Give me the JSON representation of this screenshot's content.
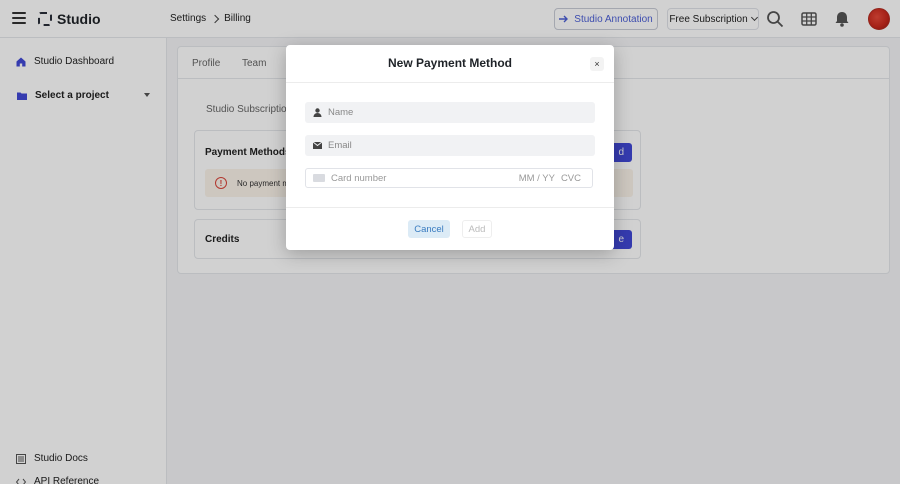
{
  "app": {
    "name": "Studio"
  },
  "breadcrumb": {
    "items": [
      "Settings",
      "Billing"
    ]
  },
  "header": {
    "annotation_label": "Studio Annotation",
    "subscription_label": "Free Subscription"
  },
  "sidebar": {
    "dashboard_label": "Studio Dashboard",
    "project_select_label": "Select a project",
    "docs_label": "Studio Docs",
    "api_label": "API Reference"
  },
  "settings": {
    "tabs": [
      "Profile",
      "Team"
    ],
    "subtab": "Studio Subscription",
    "payment_methods_title": "Payment Methods",
    "payment_add_label": "d",
    "no_payment_text": "No payment me",
    "credits_title": "Credits",
    "credits_add_label": "e"
  },
  "modal": {
    "title": "New Payment Method",
    "close_label": "×",
    "name_placeholder": "Name",
    "email_placeholder": "Email",
    "card_placeholder": "Card number",
    "expiry_placeholder": "MM / YY",
    "cvc_placeholder": "CVC",
    "cancel_label": "Cancel",
    "add_label": "Add"
  },
  "colors": {
    "accent": "#4149d6",
    "link": "#4b5fd6",
    "alert_red": "#d9453a",
    "alert_bg": "#fbf3ea"
  },
  "icons": [
    "hamburger-icon",
    "studio-logo-icon",
    "chevron-right-icon",
    "arrow-right-icon",
    "chevron-down-icon",
    "search-icon",
    "grid-icon",
    "bell-icon",
    "home-icon",
    "folder-icon",
    "docs-icon",
    "code-icon",
    "alert-icon",
    "user-icon",
    "mail-icon",
    "credit-card-icon",
    "close-icon"
  ]
}
